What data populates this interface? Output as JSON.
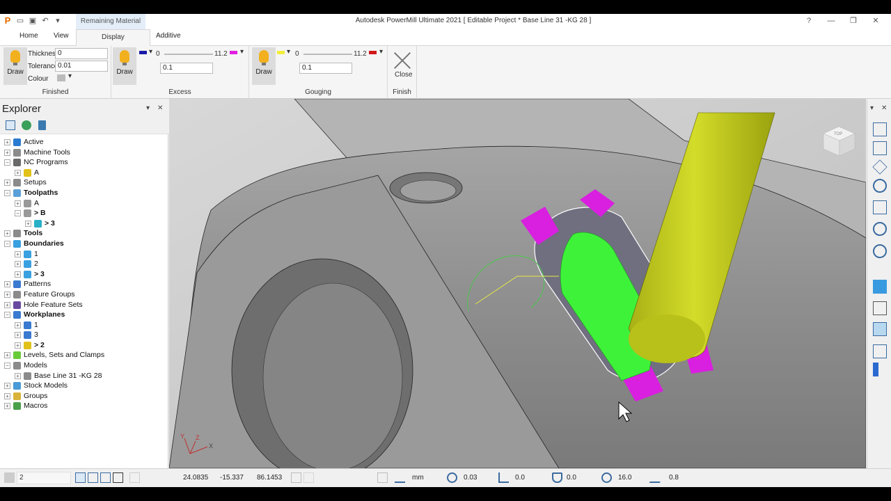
{
  "window": {
    "title": "Autodesk PowerMill Ultimate 2021    [ Editable Project * Base  Line 31  -KG 28 ]",
    "context_tab": "Remaining Material",
    "controls": [
      "?",
      "—",
      "❐",
      "✕"
    ]
  },
  "tabs": [
    "Home",
    "View",
    "Display",
    "Additive"
  ],
  "ribbon": {
    "finished": {
      "group_label": "Finished",
      "draw_label": "Draw",
      "thickness_label": "Thickness",
      "thickness_value": "0",
      "tolerance_label": "Tolerance",
      "tolerance_value": "0.01",
      "colour_label": "Colour"
    },
    "excess": {
      "group_label": "Excess",
      "draw_label": "Draw",
      "min": "0",
      "max": "11.2",
      "value": "0.1",
      "min_color": "#1a1aa8",
      "max_color": "#e020e0"
    },
    "gouging": {
      "group_label": "Gouging",
      "draw_label": "Draw",
      "min": "0",
      "max": "11.2",
      "value": "0.1",
      "min_color": "#f2ee3a",
      "max_color": "#d01818"
    },
    "finish": {
      "group_label": "Finish",
      "close_label": "Close"
    }
  },
  "explorer": {
    "title": "Explorer",
    "nodes": [
      {
        "label": "Active",
        "level": 0,
        "icon": "active-icon",
        "color": "#2a7bd0"
      },
      {
        "label": "Machine Tools",
        "level": 0,
        "icon": "machine-tools-icon",
        "color": "#8b8b8b"
      },
      {
        "label": "NC Programs",
        "level": 0,
        "icon": "nc-programs-icon",
        "color": "#6a6a6a",
        "expanded": true
      },
      {
        "label": "A",
        "level": 1,
        "icon": "nc-program-icon",
        "color": "#e2c21a"
      },
      {
        "label": "Setups",
        "level": 0,
        "icon": "setups-icon",
        "color": "#8b8b8b"
      },
      {
        "label": "Toolpaths",
        "level": 0,
        "icon": "toolpaths-icon",
        "color": "#5aa0d8",
        "bold": true,
        "expanded": true
      },
      {
        "label": "A",
        "level": 1,
        "icon": "folder-icon",
        "color": "#999"
      },
      {
        "label": "> B",
        "level": 1,
        "icon": "folder-icon",
        "color": "#999",
        "bold": true,
        "expanded": true
      },
      {
        "label": "> 3",
        "level": 2,
        "icon": "toolpath-icon",
        "color": "#2ab0c8",
        "bold": true
      },
      {
        "label": "Tools",
        "level": 0,
        "icon": "tools-icon",
        "color": "#8b8b8b",
        "bold": true
      },
      {
        "label": "Boundaries",
        "level": 0,
        "icon": "boundaries-icon",
        "color": "#3aa0e0",
        "bold": true,
        "expanded": true
      },
      {
        "label": "1",
        "level": 1,
        "icon": "boundary-icon",
        "color": "#3aa0e0"
      },
      {
        "label": "2",
        "level": 1,
        "icon": "boundary-icon",
        "color": "#3aa0e0"
      },
      {
        "label": "> 3",
        "level": 1,
        "icon": "boundary-icon",
        "color": "#3aa0e0",
        "bold": true
      },
      {
        "label": "Patterns",
        "level": 0,
        "icon": "patterns-icon",
        "color": "#3a7ad0"
      },
      {
        "label": "Feature Groups",
        "level": 0,
        "icon": "feature-groups-icon",
        "color": "#8b8b8b"
      },
      {
        "label": "Hole Feature Sets",
        "level": 0,
        "icon": "hole-feature-sets-icon",
        "color": "#6a4aa0"
      },
      {
        "label": "Workplanes",
        "level": 0,
        "icon": "workplanes-icon",
        "color": "#3a7ad0",
        "bold": true,
        "expanded": true
      },
      {
        "label": "1",
        "level": 1,
        "icon": "workplane-icon",
        "color": "#3a7ad0"
      },
      {
        "label": "3",
        "level": 1,
        "icon": "workplane-icon",
        "color": "#3a7ad0"
      },
      {
        "label": "> 2",
        "level": 1,
        "icon": "workplane-icon",
        "color": "#e2c21a",
        "bold": true
      },
      {
        "label": "Levels, Sets and Clamps",
        "level": 0,
        "icon": "levels-icon",
        "color": "#6acb3a"
      },
      {
        "label": "Models",
        "level": 0,
        "icon": "models-icon",
        "color": "#8b8b8b",
        "expanded": true
      },
      {
        "label": "Base  Line 31  -KG 28",
        "level": 1,
        "icon": "model-icon",
        "color": "#8b8b8b"
      },
      {
        "label": "Stock Models",
        "level": 0,
        "icon": "stock-models-icon",
        "color": "#4a9ad8"
      },
      {
        "label": "Groups",
        "level": 0,
        "icon": "groups-icon",
        "color": "#d8b23a"
      },
      {
        "label": "Macros",
        "level": 0,
        "icon": "macros-icon",
        "color": "#4aa04a"
      }
    ]
  },
  "axis_labels": {
    "x": "X",
    "y": "Y",
    "z": "Z"
  },
  "viewcube_label": "TOP",
  "statusbar": {
    "combo_value": "2",
    "x": "24.0835",
    "y": "-15.337",
    "z": "86.1453",
    "units": "mm",
    "tolerance": "0.03",
    "thickness": "0.0",
    "axial_thickness": "0.0",
    "diameter": "16.0",
    "stepover": "0.8"
  }
}
